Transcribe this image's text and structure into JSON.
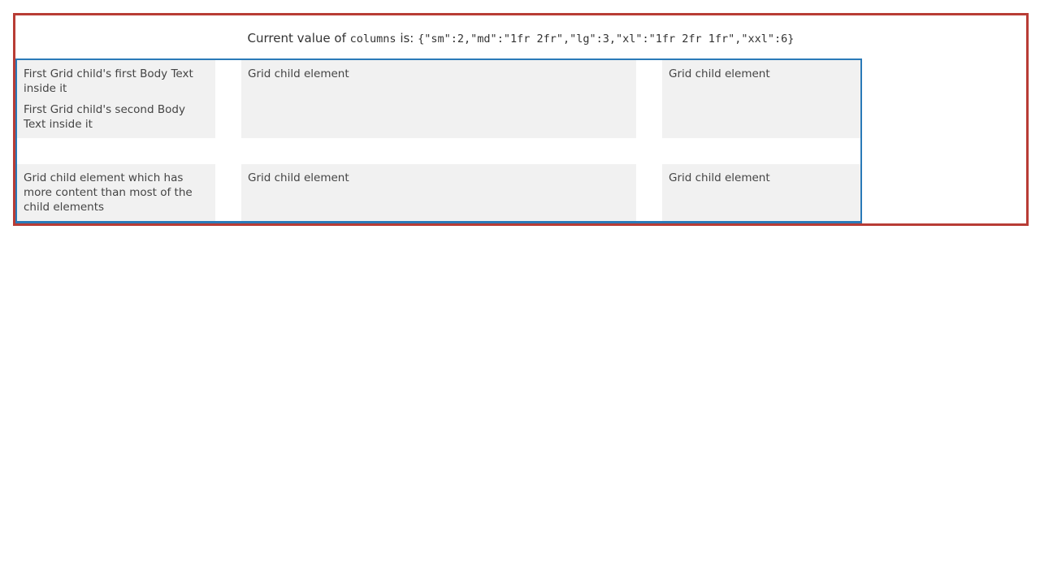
{
  "caption": {
    "prefix": "Current value of",
    "prop_name": "columns",
    "middle": "is:",
    "value": "{\"sm\":2,\"md\":\"1fr 2fr\",\"lg\":3,\"xl\":\"1fr 2fr 1fr\",\"xxl\":6}"
  },
  "grid": {
    "cells": [
      {
        "texts": [
          "First Grid child's first Body Text inside it",
          "First Grid child's second Body Text inside it"
        ]
      },
      {
        "text": "Grid child element"
      },
      {
        "text": "Grid child element"
      },
      {
        "text": "Grid child element which has more content than most of the child elements"
      },
      {
        "text": "Grid child element"
      },
      {
        "text": "Grid child element"
      }
    ]
  }
}
